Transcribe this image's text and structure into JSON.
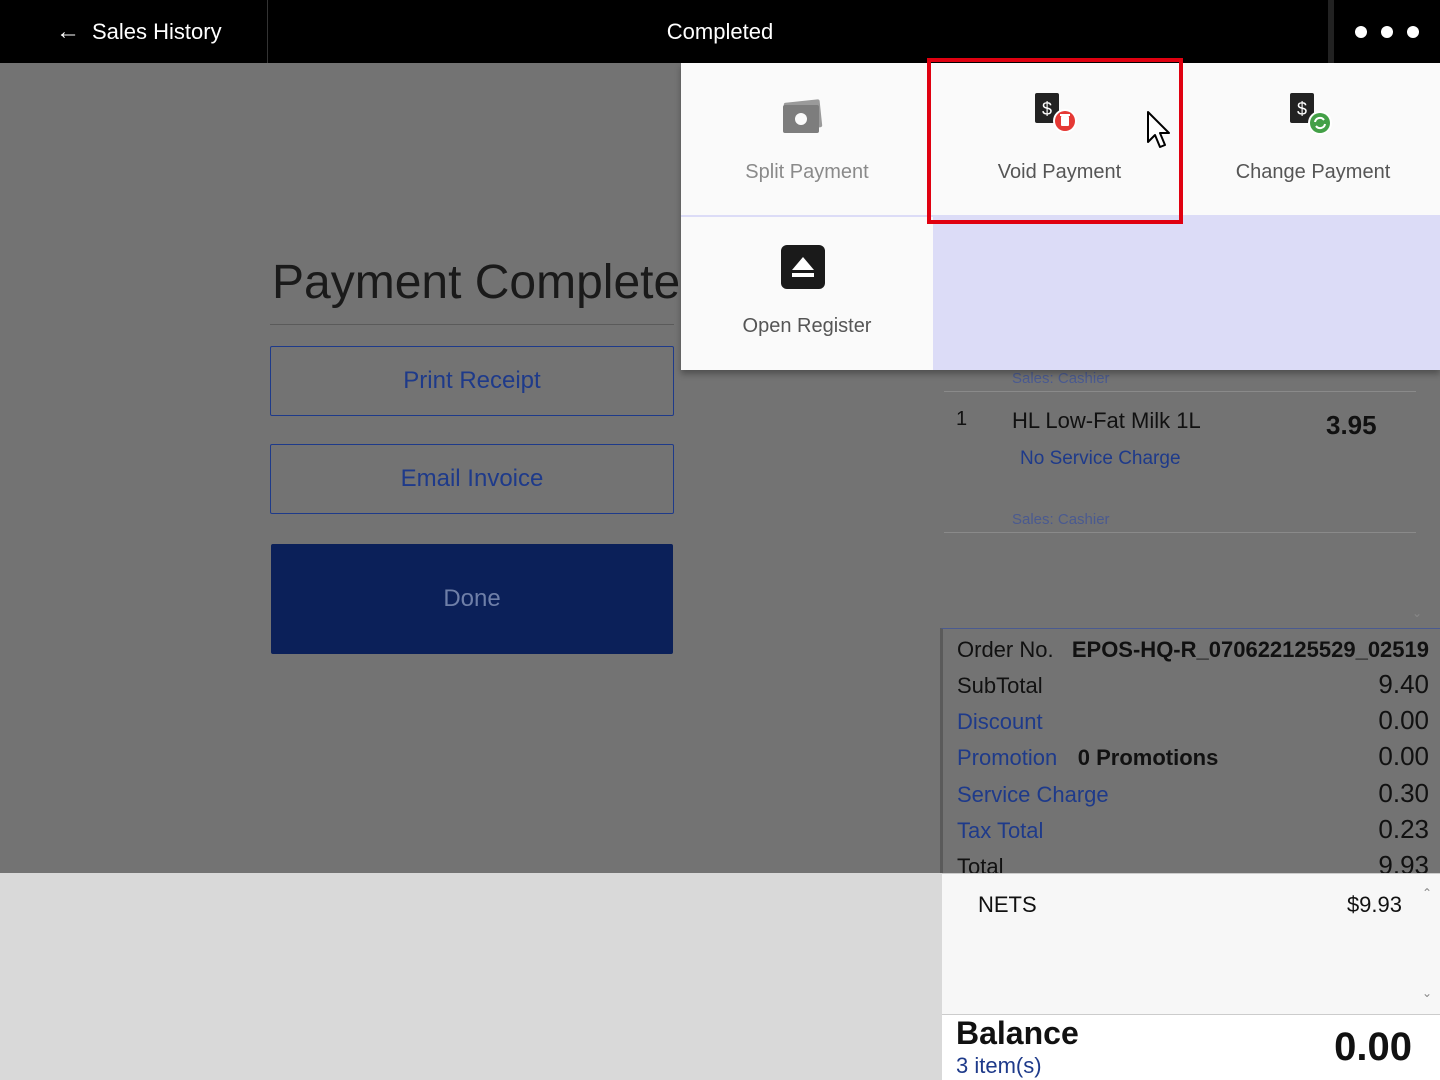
{
  "header": {
    "back_label": "Sales History",
    "back_icon": "arrow-left-icon",
    "title": "Completed",
    "more_icon": "more-horizontal-icon"
  },
  "payment": {
    "title": "Payment Complete",
    "print_label": "Print Receipt",
    "email_label": "Email Invoice",
    "done_label": "Done"
  },
  "menu": {
    "split_label": "Split Payment",
    "void_label": "Void Payment",
    "change_label": "Change Payment",
    "register_label": "Open Register"
  },
  "order": {
    "sales_label_1": "Sales: Cashier",
    "item": {
      "qty": "1",
      "name": "HL Low-Fat Milk 1L",
      "price": "3.95",
      "service": "No Service Charge"
    },
    "sales_label_2": "Sales: Cashier"
  },
  "totals": {
    "order_no_label": "Order No.",
    "order_no": "EPOS-HQ-R_070622125529_02519",
    "subtotal_label": "SubTotal",
    "subtotal": "9.40",
    "discount_label": "Discount",
    "discount": "0.00",
    "promotion_label": "Promotion",
    "promotion_count": "0 Promotions",
    "promotion": "0.00",
    "service_label": "Service Charge",
    "service": "0.30",
    "tax_label": "Tax Total",
    "tax": "0.23",
    "total_label": "Total",
    "total": "9.93"
  },
  "payments": {
    "method": "NETS",
    "amount": "$9.93"
  },
  "balance": {
    "label": "Balance",
    "items": "3 item(s)",
    "value": "0.00"
  },
  "colors": {
    "accent": "#1e3a8a",
    "done_bg": "#0b2059",
    "highlight": "#e00010",
    "menu_bg": "#dcdcf7"
  }
}
